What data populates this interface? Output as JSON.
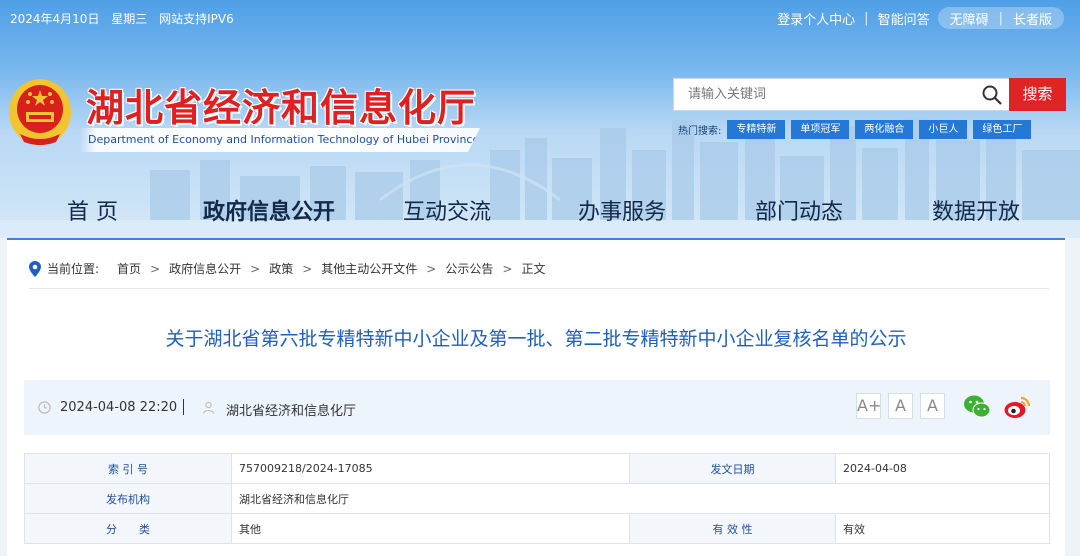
{
  "topbar": {
    "date": "2024年4月10日",
    "weekday": "星期三",
    "ipv6": "网站支持IPV6",
    "login": "登录个人中心",
    "qa": "智能问答",
    "accessible": "无障碍",
    "elderly": "长者版"
  },
  "site": {
    "title": "湖北省经济和信息化厅",
    "english": "Department of Economy and Information Technology of Hubei Province"
  },
  "search": {
    "placeholder": "请输入关键词",
    "button": "搜索",
    "hot_label": "热门搜索:",
    "hot_tags": [
      "专精特新",
      "单项冠军",
      "两化融合",
      "小巨人",
      "绿色工厂"
    ]
  },
  "nav": [
    "首  页",
    "政府信息公开",
    "互动交流",
    "办事服务",
    "部门动态",
    "数据开放"
  ],
  "breadcrumb": {
    "label": "当前位置:",
    "items": [
      "首页",
      "政府信息公开",
      "政策",
      "其他主动公开文件",
      "公示公告",
      "正文"
    ]
  },
  "article": {
    "title": "关于湖北省第六批专精特新中小企业及第一批、第二批专精特新中小企业复核名单的公示",
    "datetime": "2024-04-08 22:20",
    "publisher": "湖北省经济和信息化厅",
    "font_buttons": [
      "A+",
      "A",
      "A"
    ]
  },
  "info_table": {
    "index_label": "索 引 号",
    "index_value": "757009218/2024-17085",
    "date_label": "发文日期",
    "date_value": "2024-04-08",
    "org_label": "发布机构",
    "org_value": "湖北省经济和信息化厅",
    "category_label": "分　　类",
    "category_value": "其他",
    "validity_label": "有 效 性",
    "validity_value": "有效"
  },
  "colors": {
    "accent": "#2578d6",
    "brand_red": "#e02020",
    "title_blue": "#1f5fbf"
  },
  "icons": [
    "search-icon",
    "pin-icon",
    "clock-icon",
    "org-icon",
    "wechat-icon",
    "weibo-icon",
    "emblem-icon"
  ]
}
